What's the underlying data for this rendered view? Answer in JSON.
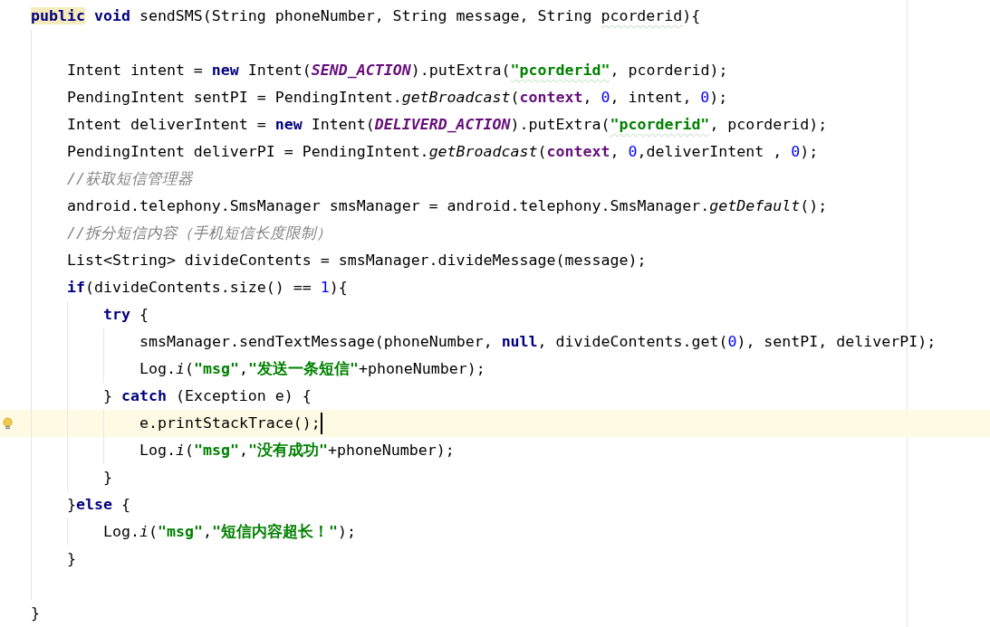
{
  "editor": {
    "lines": [
      {
        "kind": "code",
        "current": false,
        "tokens": [
          {
            "kind": "keyword",
            "text": "public",
            "highlighted": true
          },
          {
            "kind": "keyword",
            "text": " void"
          },
          {
            "kind": "plain",
            "text": " sendSMS(String phoneNumber, String message, String "
          },
          {
            "kind": "plain",
            "text": "pcorderid",
            "warning": true
          },
          {
            "kind": "plain",
            "text": "){"
          }
        ],
        "children": [
          {
            "kind": "blank"
          },
          {
            "kind": "code",
            "current": false,
            "tokens": [
              {
                "kind": "plain",
                "text": "Intent intent = "
              },
              {
                "kind": "keyword",
                "text": "new"
              },
              {
                "kind": "plain",
                "text": " Intent("
              },
              {
                "kind": "constant",
                "text": "SEND_ACTION"
              },
              {
                "kind": "plain",
                "text": ").putExtra("
              },
              {
                "kind": "string",
                "text": "\"pcorderid\"",
                "warning": true
              },
              {
                "kind": "plain",
                "text": ", pcorderid);"
              }
            ]
          },
          {
            "kind": "code",
            "current": false,
            "tokens": [
              {
                "kind": "plain",
                "text": "PendingIntent sentPI = PendingIntent."
              },
              {
                "kind": "static",
                "text": "getBroadcast"
              },
              {
                "kind": "plain",
                "text": "("
              },
              {
                "kind": "field",
                "text": "context"
              },
              {
                "kind": "plain",
                "text": ", "
              },
              {
                "kind": "number",
                "text": "0"
              },
              {
                "kind": "plain",
                "text": ", intent, "
              },
              {
                "kind": "number",
                "text": "0"
              },
              {
                "kind": "plain",
                "text": ");"
              }
            ]
          },
          {
            "kind": "code",
            "current": false,
            "tokens": [
              {
                "kind": "plain",
                "text": "Intent deliverIntent = "
              },
              {
                "kind": "keyword",
                "text": "new"
              },
              {
                "kind": "plain",
                "text": " Intent("
              },
              {
                "kind": "constant",
                "text": "DELIVERD_ACTION"
              },
              {
                "kind": "plain",
                "text": ").putExtra("
              },
              {
                "kind": "string",
                "text": "\"pcorderid\"",
                "warning": true
              },
              {
                "kind": "plain",
                "text": ", pcorderid);"
              }
            ]
          },
          {
            "kind": "code",
            "current": false,
            "tokens": [
              {
                "kind": "plain",
                "text": "PendingIntent deliverPI = PendingIntent."
              },
              {
                "kind": "static",
                "text": "getBroadcast"
              },
              {
                "kind": "plain",
                "text": "("
              },
              {
                "kind": "field",
                "text": "context"
              },
              {
                "kind": "plain",
                "text": ", "
              },
              {
                "kind": "number",
                "text": "0"
              },
              {
                "kind": "plain",
                "text": ",deliverIntent , "
              },
              {
                "kind": "number",
                "text": "0"
              },
              {
                "kind": "plain",
                "text": ");"
              }
            ]
          },
          {
            "kind": "code",
            "current": false,
            "tokens": [
              {
                "kind": "comment",
                "text": "//获取短信管理器"
              }
            ]
          },
          {
            "kind": "code",
            "current": false,
            "tokens": [
              {
                "kind": "plain",
                "text": "android.telephony.SmsManager smsManager = android.telephony.SmsManager."
              },
              {
                "kind": "static",
                "text": "getDefault"
              },
              {
                "kind": "plain",
                "text": "();"
              }
            ]
          },
          {
            "kind": "code",
            "current": false,
            "tokens": [
              {
                "kind": "comment",
                "text": "//拆分短信内容（手机短信长度限制）"
              }
            ]
          },
          {
            "kind": "code",
            "current": false,
            "tokens": [
              {
                "kind": "plain",
                "text": "List<String> divideContents = smsManager.divideMessage(message);"
              }
            ]
          },
          {
            "kind": "code",
            "current": false,
            "tokens": [
              {
                "kind": "keyword",
                "text": "if"
              },
              {
                "kind": "plain",
                "text": "(divideContents.size() == "
              },
              {
                "kind": "number",
                "text": "1"
              },
              {
                "kind": "plain",
                "text": "){"
              }
            ],
            "children": [
              {
                "kind": "code",
                "current": false,
                "tokens": [
                  {
                    "kind": "keyword",
                    "text": "try"
                  },
                  {
                    "kind": "plain",
                    "text": " {"
                  }
                ],
                "children": [
                  {
                    "kind": "code",
                    "current": false,
                    "tokens": [
                      {
                        "kind": "plain",
                        "text": "smsManager.sendTextMessage(phoneNumber, "
                      },
                      {
                        "kind": "keyword",
                        "text": "null"
                      },
                      {
                        "kind": "plain",
                        "text": ", divideContents.get("
                      },
                      {
                        "kind": "number",
                        "text": "0"
                      },
                      {
                        "kind": "plain",
                        "text": "), sentPI, deliverPI);"
                      }
                    ]
                  },
                  {
                    "kind": "code",
                    "current": false,
                    "tokens": [
                      {
                        "kind": "plain",
                        "text": "Log."
                      },
                      {
                        "kind": "static",
                        "text": "i"
                      },
                      {
                        "kind": "plain",
                        "text": "("
                      },
                      {
                        "kind": "string",
                        "text": "\"msg\""
                      },
                      {
                        "kind": "plain",
                        "text": ","
                      },
                      {
                        "kind": "string",
                        "text": "\"发送一条短信\""
                      },
                      {
                        "kind": "plain",
                        "text": "+phoneNumber);"
                      }
                    ]
                  }
                ]
              },
              {
                "kind": "code",
                "current": false,
                "tokens": [
                  {
                    "kind": "plain",
                    "text": "} "
                  },
                  {
                    "kind": "keyword",
                    "text": "catch"
                  },
                  {
                    "kind": "plain",
                    "text": " (Exception e) {"
                  }
                ],
                "children": [
                  {
                    "kind": "code",
                    "current": true,
                    "tokens": [
                      {
                        "kind": "plain",
                        "text": "e.printStackTrace();"
                      }
                    ]
                  },
                  {
                    "kind": "code",
                    "current": false,
                    "tokens": [
                      {
                        "kind": "plain",
                        "text": "Log."
                      },
                      {
                        "kind": "static",
                        "text": "i"
                      },
                      {
                        "kind": "plain",
                        "text": "("
                      },
                      {
                        "kind": "string",
                        "text": "\"msg\""
                      },
                      {
                        "kind": "plain",
                        "text": ","
                      },
                      {
                        "kind": "string",
                        "text": "\"没有成功\""
                      },
                      {
                        "kind": "plain",
                        "text": "+phoneNumber);"
                      }
                    ]
                  }
                ]
              },
              {
                "kind": "code",
                "current": false,
                "tokens": [
                  {
                    "kind": "plain",
                    "text": "}"
                  }
                ]
              }
            ]
          },
          {
            "kind": "code",
            "current": false,
            "tokens": [
              {
                "kind": "plain",
                "text": "}"
              },
              {
                "kind": "keyword",
                "text": "else"
              },
              {
                "kind": "plain",
                "text": " {"
              }
            ],
            "children": [
              {
                "kind": "code",
                "current": false,
                "tokens": [
                  {
                    "kind": "plain",
                    "text": "Log."
                  },
                  {
                    "kind": "static",
                    "text": "i"
                  },
                  {
                    "kind": "plain",
                    "text": "("
                  },
                  {
                    "kind": "string",
                    "text": "\"msg\""
                  },
                  {
                    "kind": "plain",
                    "text": ","
                  },
                  {
                    "kind": "string",
                    "text": "\"短信内容超长！\""
                  },
                  {
                    "kind": "plain",
                    "text": ");"
                  }
                ]
              }
            ]
          },
          {
            "kind": "code",
            "current": false,
            "tokens": [
              {
                "kind": "plain",
                "text": "}"
              }
            ]
          },
          {
            "kind": "blank"
          }
        ]
      },
      {
        "kind": "code",
        "current": false,
        "tokens": [
          {
            "kind": "plain",
            "text": "}"
          }
        ]
      }
    ]
  }
}
